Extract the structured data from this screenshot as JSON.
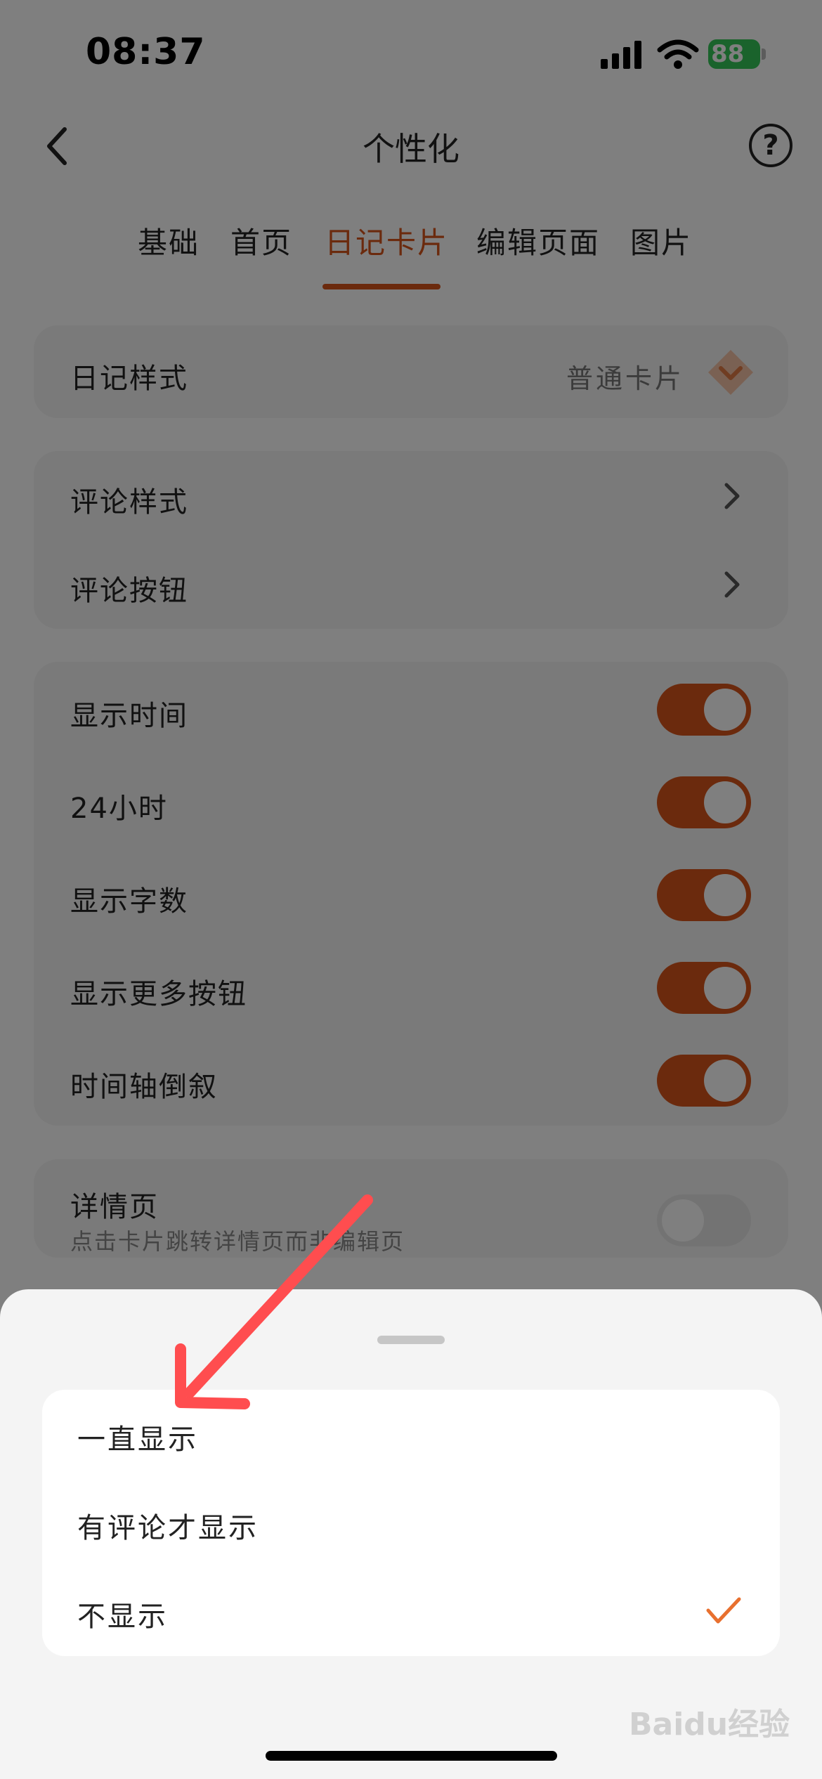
{
  "status_bar": {
    "time": "08:37",
    "battery": "88"
  },
  "header": {
    "title": "个性化",
    "back_icon": "chevron-left-icon",
    "help_icon": "question-circle-icon",
    "help_glyph": "?"
  },
  "tabs": [
    {
      "label": "基础",
      "active": false
    },
    {
      "label": "首页",
      "active": false
    },
    {
      "label": "日记卡片",
      "active": true
    },
    {
      "label": "编辑页面",
      "active": false
    },
    {
      "label": "图片",
      "active": false
    }
  ],
  "diary_style": {
    "label": "日记样式",
    "value": "普通卡片",
    "icon": "diamond-icon"
  },
  "comment_group": [
    {
      "label": "评论样式"
    },
    {
      "label": "评论按钮"
    }
  ],
  "toggles": [
    {
      "label": "显示时间",
      "on": true
    },
    {
      "label": "24小时",
      "on": true
    },
    {
      "label": "显示字数",
      "on": true
    },
    {
      "label": "显示更多按钮",
      "on": true
    },
    {
      "label": "时间轴倒叙",
      "on": true
    }
  ],
  "detail_page": {
    "label": "详情页",
    "description": "点击卡片跳转详情页而非编辑页",
    "on": false
  },
  "sheet": {
    "options": [
      {
        "label": "一直显示",
        "selected": false
      },
      {
        "label": "有评论才显示",
        "selected": false
      },
      {
        "label": "不显示",
        "selected": true
      }
    ]
  },
  "watermark": "Baidu经验",
  "colors": {
    "accent": "#d7541b",
    "annotation_arrow": "#ff4d4f"
  }
}
